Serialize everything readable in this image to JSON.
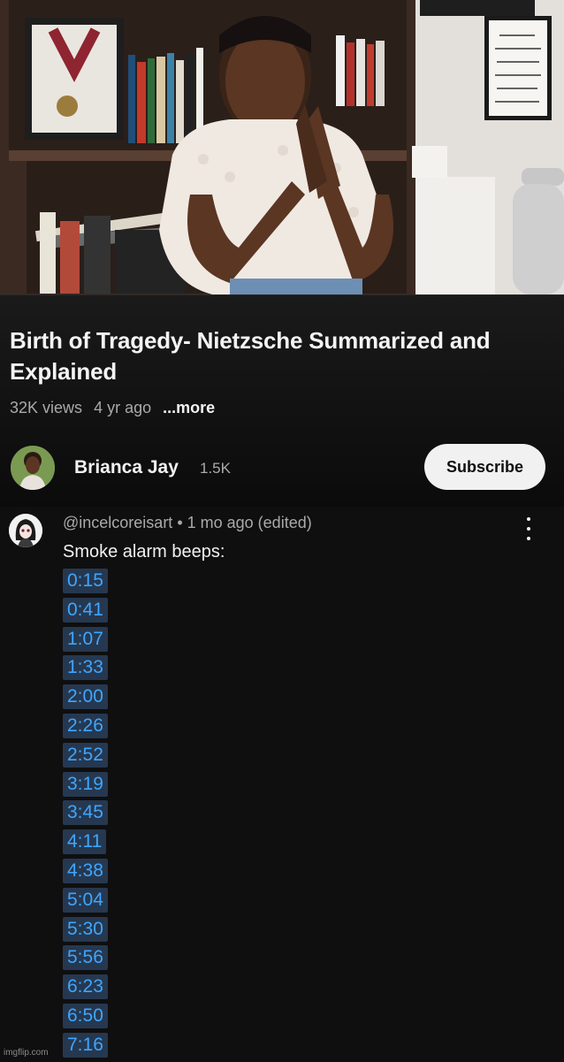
{
  "video": {
    "title": "Birth of Tragedy- Nietzsche Summarized and Explained",
    "views": "32K views",
    "age": "4 yr ago",
    "more_label": "...more"
  },
  "channel": {
    "name": "Brianca Jay",
    "subscribers": "1.5K",
    "subscribe_label": "Subscribe"
  },
  "comment": {
    "author": "@incelcoreisart",
    "separator": "•",
    "age": "1 mo ago (edited)",
    "text": "Smoke alarm beeps:",
    "timestamps": [
      "0:15",
      "0:41",
      "1:07",
      "1:33",
      "2:00",
      "2:26",
      "2:52",
      "3:19",
      "3:45",
      "4:11",
      "4:38",
      "5:04",
      "5:30",
      "5:56",
      "6:23",
      "6:50",
      "7:16"
    ],
    "menu_icon": "kebab-menu-icon"
  },
  "watermark": "imgflip.com",
  "colors": {
    "background": "#0f0f0f",
    "link": "#3ea6ff",
    "timestamp_bg": "#263850",
    "subscribe_bg": "#f1f1f1"
  }
}
